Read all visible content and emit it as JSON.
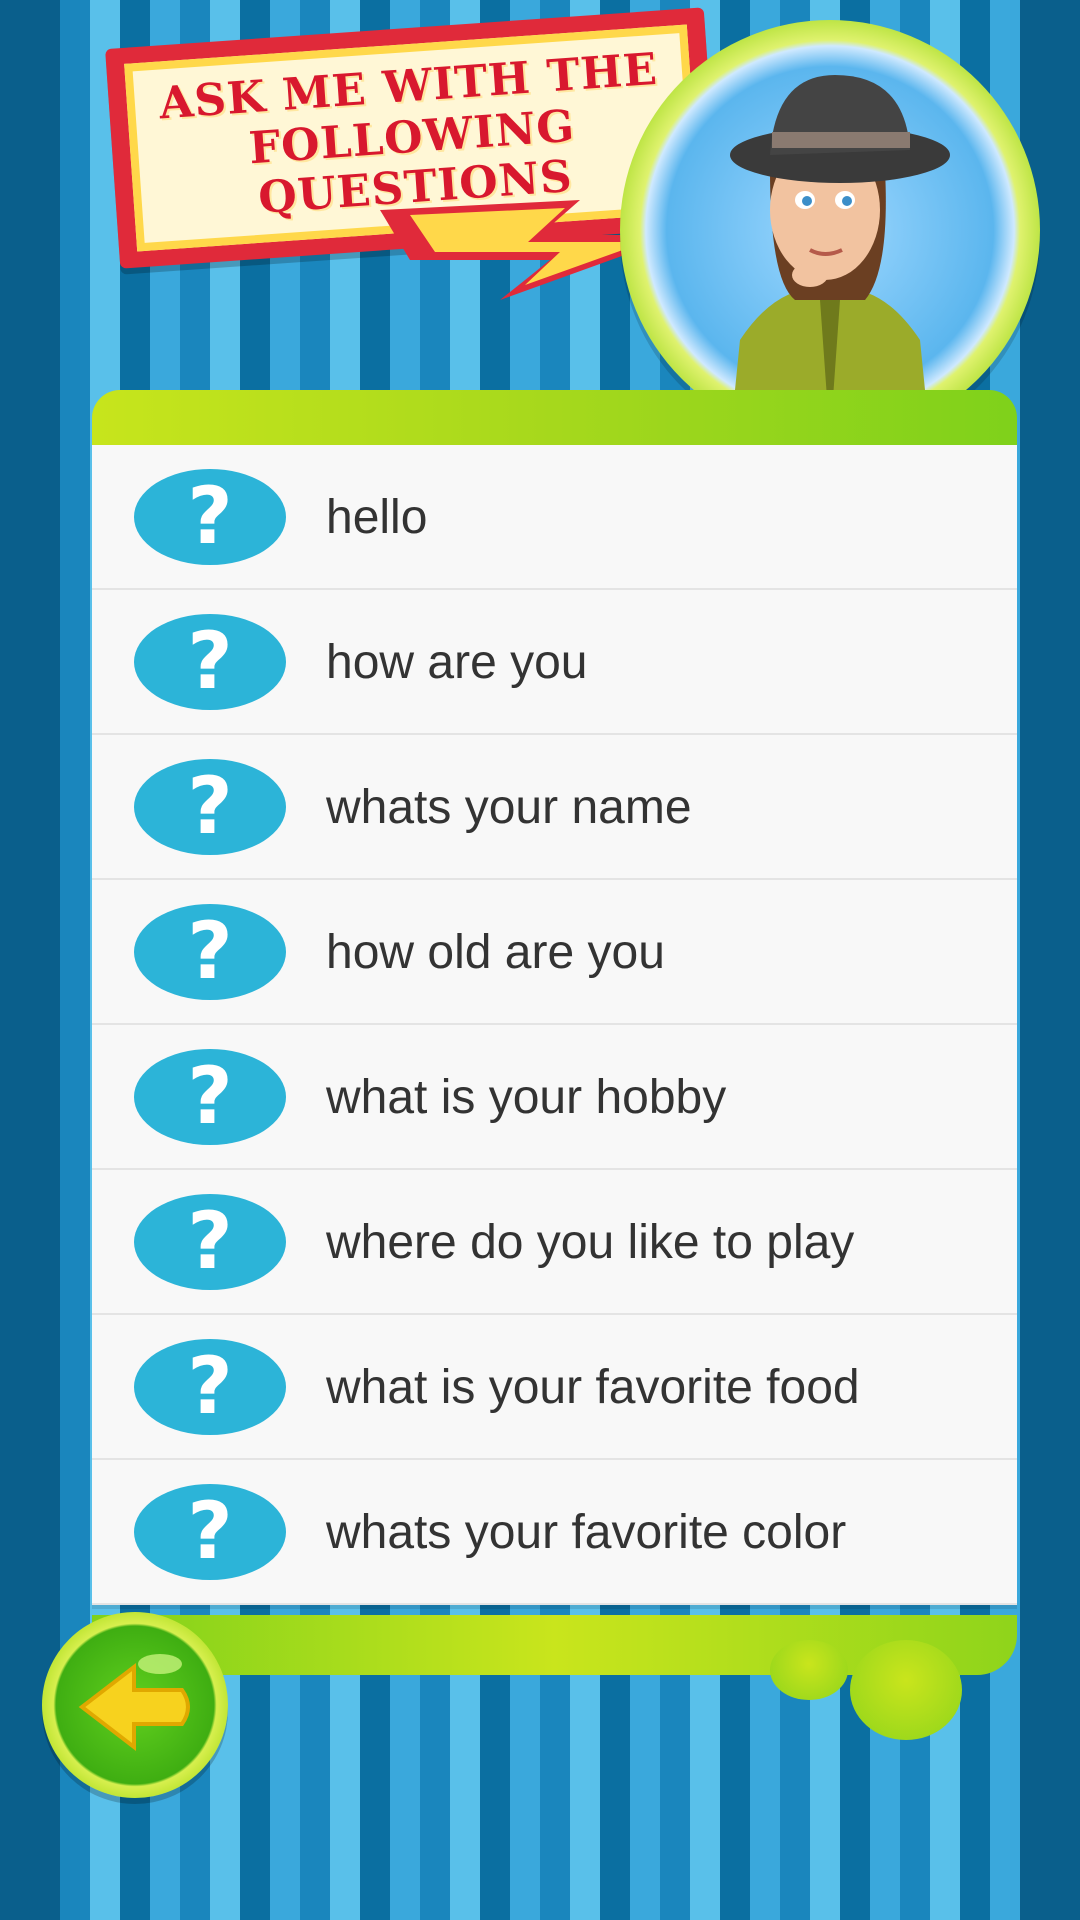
{
  "header": {
    "title_line1": "ASK ME WITH THE",
    "title_line2": "FOLLOWING QUESTIONS"
  },
  "questions": [
    {
      "icon": "question-icon",
      "text": "hello"
    },
    {
      "icon": "question-icon",
      "text": "how are you"
    },
    {
      "icon": "question-icon",
      "text": "whats your name"
    },
    {
      "icon": "question-icon",
      "text": "how old are you"
    },
    {
      "icon": "question-icon",
      "text": "what is your hobby"
    },
    {
      "icon": "question-icon",
      "text": "where do you like to play"
    },
    {
      "icon": "question-icon",
      "text": "what is your favorite food"
    },
    {
      "icon": "question-icon",
      "text": "whats your favorite color"
    }
  ],
  "question_mark": "?",
  "back_button": {
    "icon": "back-arrow-icon"
  },
  "colors": {
    "banner_red": "#e02a3a",
    "banner_yellow": "#ffd84a",
    "accent_green": "#a6d81c",
    "badge_blue": "#2cb4d8",
    "text": "#333333"
  }
}
